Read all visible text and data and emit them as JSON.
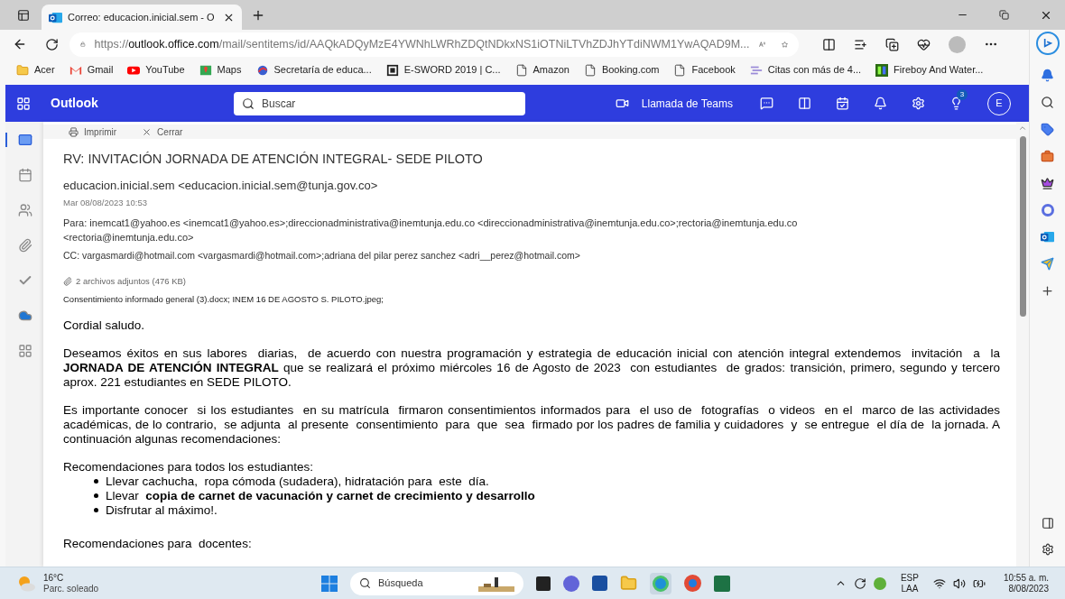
{
  "browser": {
    "tabs": [
      {
        "title": "Correo: educacion.inicial.sem - O",
        "selected": true
      }
    ],
    "url_scheme": "https://",
    "url_host": "outlook.office.com",
    "url_path": "/mail/sentitems/id/AAQkADQyMzE4YWNhLWRhZDQtNDkxNS1iOTNiLTVhZDJhYTdiNWM1YwAQAD9M...",
    "bookmarks": [
      {
        "kind": "folder",
        "label": "Acer"
      },
      {
        "kind": "gmail",
        "label": "Gmail"
      },
      {
        "kind": "youtube",
        "label": "YouTube"
      },
      {
        "kind": "maps",
        "label": "Maps"
      },
      {
        "kind": "site",
        "label": "Secretaría de educa..."
      },
      {
        "kind": "esword",
        "label": "E-SWORD 2019 | C..."
      },
      {
        "kind": "page",
        "label": "Amazon"
      },
      {
        "kind": "page",
        "label": "Booking.com"
      },
      {
        "kind": "page",
        "label": "Facebook"
      },
      {
        "kind": "lines",
        "label": "Citas con más de 4..."
      },
      {
        "kind": "game",
        "label": "Fireboy And Water..."
      }
    ]
  },
  "outlook": {
    "app_name": "Outlook",
    "search_placeholder": "Buscar",
    "teams_label": "Llamada de Teams",
    "tips_badge": "3",
    "avatar_initial": "E",
    "rail": [
      {
        "kind": "mail",
        "selected": true
      },
      {
        "kind": "calendar",
        "selected": false
      },
      {
        "kind": "people",
        "selected": false
      },
      {
        "kind": "files",
        "selected": false
      },
      {
        "kind": "todo",
        "selected": false
      },
      {
        "kind": "onedrive",
        "selected": false
      },
      {
        "kind": "apps",
        "selected": false
      }
    ]
  },
  "message": {
    "toolbar": [
      "Imprimir",
      "Cerrar"
    ],
    "subject": "RV: INVITACIÓN JORNADA DE ATENCIÓN INTEGRAL- SEDE PILOTO",
    "from": "educacion.inicial.sem <educacion.inicial.sem@tunja.gov.co>",
    "date": "Mar 08/08/2023 10:53",
    "to": "Para: inemcat1@yahoo.es <inemcat1@yahoo.es>;direccionadministrativa@inemtunja.edu.co <direccionadministrativa@inemtunja.edu.co>;rectoria@inemtunja.edu.co <rectoria@inemtunja.edu.co>",
    "cc": "CC: vargasmardi@hotmail.com <vargasmardi@hotmail.com>;adriana del pilar perez sanchez <adri__perez@hotmail.com>",
    "attachments_summary": "2 archivos adjuntos (476 KB)",
    "attachments": "Consentimiento informado general (3).docx; INEM 16 DE AGOSTO S. PILOTO.jpeg;",
    "body": [
      {
        "kind": "paragraph",
        "text": "Cordial saludo."
      },
      {
        "kind": "paragraph",
        "text": "Deseamos éxitos en sus labores  diarias,  de acuerdo con nuestra programación y estrategia de educación inicial con atención integral extendemos  invitación  a  la **JORNADA DE ATENCIÓN INTEGRAL** que se realizará el próximo miércoles 16 de Agosto de 2023  con estudiantes  de grados: transición, primero, segundo y tercero aprox. 221 estudiantes en SEDE PILOTO."
      },
      {
        "kind": "paragraph",
        "text": "Es importante conocer  si los estudiantes  en su matrícula  firmaron consentimientos informados para  el uso de  fotografías  o videos  en el  marco de las actividades  académicas, de lo contrario,  se adjunta  al presente  consentimiento  para  que  sea  firmado por los padres de familia y cuidadores  y  se entregue  el día de  la jornada. A continuación algunas recomendaciones:"
      },
      {
        "kind": "list",
        "title": "Recomendaciones para todos los estudiantes:",
        "items": [
          "Llevar cachucha,  ropa cómoda (sudadera), hidratación para  este  día.",
          "Llevar  **copia de carnet de vacunación y carnet de crecimiento y desarrollo**",
          "Disfrutar al máximo!."
        ]
      },
      {
        "kind": "paragraph",
        "text": "Recomendaciones para  docentes:"
      }
    ]
  },
  "taskbar": {
    "temperature": "16°C",
    "weather": "Parc. soleado",
    "search_placeholder": "Búsqueda",
    "language": "ESP",
    "layout": "LAA",
    "time": "10:55 a. m.",
    "date": "8/08/2023"
  }
}
